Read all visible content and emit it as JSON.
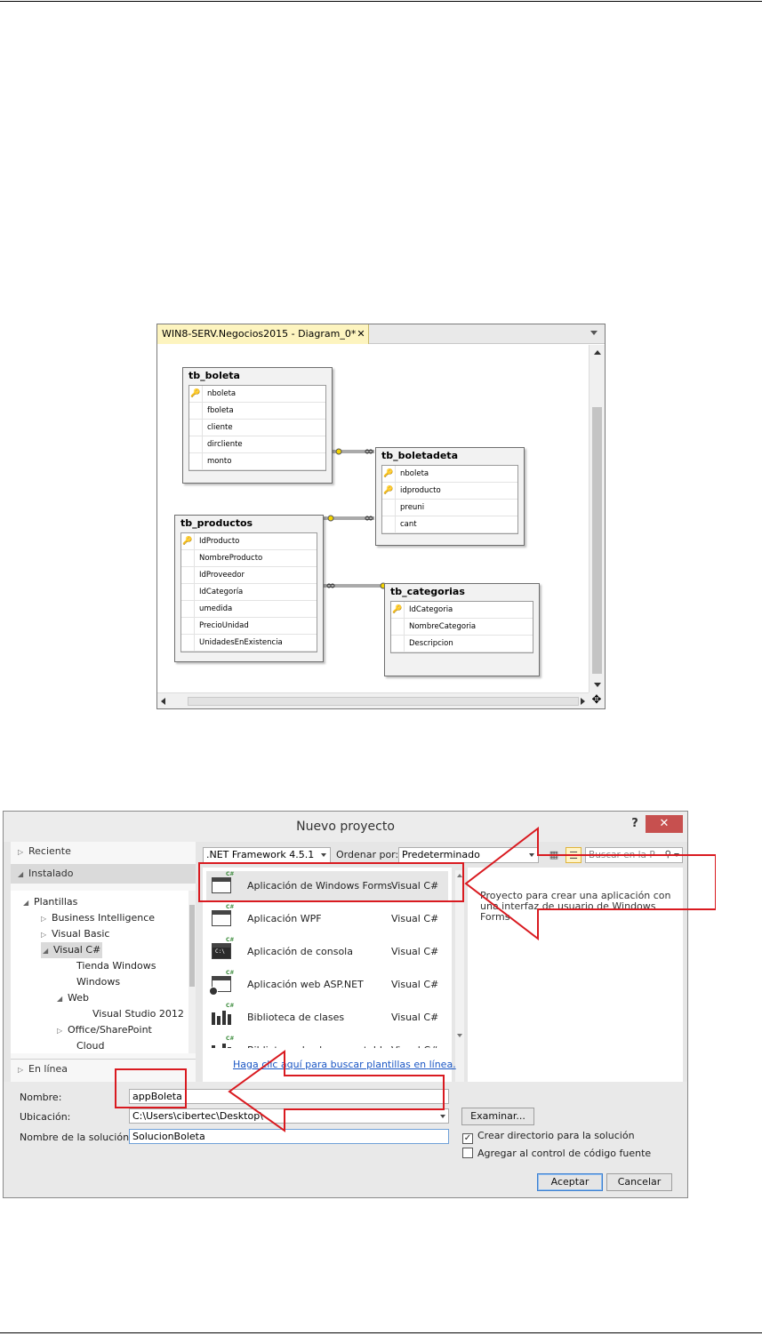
{
  "diagram": {
    "tab_title": "WIN8-SERV.Negocios2015 - Diagram_0*",
    "tab_close": "✕",
    "move_glyph": "✥",
    "key_glyph": "🔑",
    "tables": [
      {
        "name": "tb_boleta",
        "columns": [
          {
            "name": "nboleta",
            "key": true
          },
          {
            "name": "fboleta",
            "key": false
          },
          {
            "name": "cliente",
            "key": false
          },
          {
            "name": "dircliente",
            "key": false
          },
          {
            "name": "monto",
            "key": false
          }
        ]
      },
      {
        "name": "tb_boletadeta",
        "columns": [
          {
            "name": "nboleta",
            "key": true
          },
          {
            "name": "idproducto",
            "key": true
          },
          {
            "name": "preuni",
            "key": false
          },
          {
            "name": "cant",
            "key": false
          }
        ]
      },
      {
        "name": "tb_productos",
        "columns": [
          {
            "name": "IdProducto",
            "key": true
          },
          {
            "name": "NombreProducto",
            "key": false
          },
          {
            "name": "IdProveedor",
            "key": false
          },
          {
            "name": "IdCategoría",
            "key": false
          },
          {
            "name": "umedida",
            "key": false
          },
          {
            "name": "PrecioUnidad",
            "key": false
          },
          {
            "name": "UnidadesEnExistencia",
            "key": false
          }
        ]
      },
      {
        "name": "tb_categorias",
        "columns": [
          {
            "name": "IdCategoria",
            "key": true
          },
          {
            "name": "NombreCategoria",
            "key": false
          },
          {
            "name": "Descripcion",
            "key": false
          }
        ]
      }
    ]
  },
  "dialog": {
    "title": "Nuevo proyecto",
    "help": "?",
    "close": "✕",
    "sections": {
      "recent": "Reciente",
      "installed": "Instalado",
      "online": "En línea"
    },
    "tree": [
      {
        "label": "Plantillas",
        "tri": "◢",
        "selected": false
      },
      {
        "label": "Business Intelligence",
        "tri": "▷",
        "selected": false
      },
      {
        "label": "Visual Basic",
        "tri": "▷",
        "selected": false
      },
      {
        "label": "Visual C#",
        "tri": "◢",
        "selected": true
      },
      {
        "label": "Tienda Windows",
        "tri": "",
        "selected": false
      },
      {
        "label": "Windows",
        "tri": "",
        "selected": false
      },
      {
        "label": "Web",
        "tri": "◢",
        "selected": false
      },
      {
        "label": "Visual Studio 2012",
        "tri": "",
        "selected": false
      },
      {
        "label": "Office/SharePoint",
        "tri": "▷",
        "selected": false
      },
      {
        "label": "Cloud",
        "tri": "",
        "selected": false
      }
    ],
    "toolbar": {
      "framework": ".NET Framework 4.5.1",
      "sort_label": "Ordenar por:",
      "sort_value": "Predeterminado",
      "search_placeholder": "Buscar en la P",
      "search_icon": "⚲",
      "grid_icon": "▦",
      "list_icon": "☰"
    },
    "templates": [
      {
        "name": "Aplicación de Windows Forms",
        "lang": "Visual C#",
        "selected": true
      },
      {
        "name": "Aplicación WPF",
        "lang": "Visual C#",
        "selected": false
      },
      {
        "name": "Aplicación de consola",
        "lang": "Visual C#",
        "selected": false
      },
      {
        "name": "Aplicación web ASP.NET",
        "lang": "Visual C#",
        "selected": false
      },
      {
        "name": "Biblioteca de clases",
        "lang": "Visual C#",
        "selected": false
      },
      {
        "name": "Biblioteca de clases portable",
        "lang": "Visual C#",
        "selected": false
      }
    ],
    "console_glyph": "C:\\",
    "cs_badge": "C#",
    "online_link": "Haga clic aquí para buscar plantillas en línea.",
    "description": "Proyecto para crear una aplicación con una interfaz de usuario de Windows Forms",
    "form": {
      "name_label": "Nombre:",
      "name_value": "appBoleta",
      "location_label": "Ubicación:",
      "location_value": "C:\\Users\\cibertec\\Desktop\\",
      "solution_label": "Nombre de la solución:",
      "solution_value": "SolucionBoleta",
      "browse": "Examinar...",
      "create_dir": "Crear directorio para la solución",
      "create_dir_checked": true,
      "check_glyph": "✓",
      "source_control": "Agregar al control de código fuente",
      "source_control_checked": false,
      "accept": "Aceptar",
      "cancel": "Cancelar"
    }
  },
  "colors": {
    "annotation": "#d91a20",
    "tab": "#fdf4bf",
    "close_button": "#c7504f",
    "link": "#1a56c4"
  }
}
